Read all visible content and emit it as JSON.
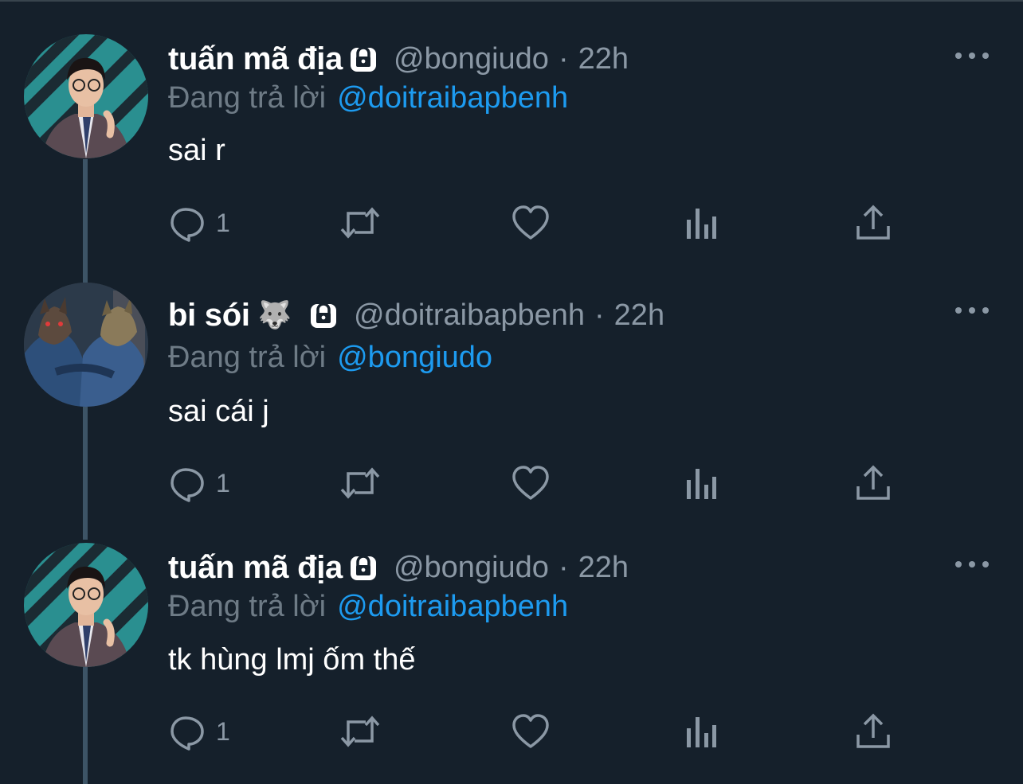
{
  "tweets": [
    {
      "display_name": "tuấn mã địa",
      "name_emoji": "",
      "handle": "@bongiudo",
      "separator": "·",
      "time": "22h",
      "reply_prefix": "Đang trả lời",
      "reply_to": "@doitraibapbenh",
      "text": "sai r",
      "reply_count": "1",
      "avatar": "person-in-suit"
    },
    {
      "display_name": "bi sói",
      "name_emoji": "🐺",
      "handle": "@doitraibapbenh",
      "separator": "·",
      "time": "22h",
      "reply_prefix": "Đang trả lời",
      "reply_to": "@bongiudo",
      "text": "sai cái j",
      "reply_count": "1",
      "avatar": "werewolves-art"
    },
    {
      "display_name": "tuấn mã địa",
      "name_emoji": "",
      "handle": "@bongiudo",
      "separator": "·",
      "time": "22h",
      "reply_prefix": "Đang trả lời",
      "reply_to": "@doitraibapbenh",
      "text": "tk hùng lmj ốm thế",
      "reply_count": "1",
      "avatar": "person-in-suit"
    }
  ],
  "icons": {
    "reply": "reply-icon",
    "retweet": "retweet-icon",
    "like": "heart-icon",
    "views": "analytics-icon",
    "share": "share-icon",
    "lock": "lock-icon",
    "more": "more-icon"
  },
  "colors": {
    "background": "#15202b",
    "text": "#ffffff",
    "secondary": "#8b98a5",
    "link": "#1d9bf0",
    "thread_line": "#3d5466"
  }
}
